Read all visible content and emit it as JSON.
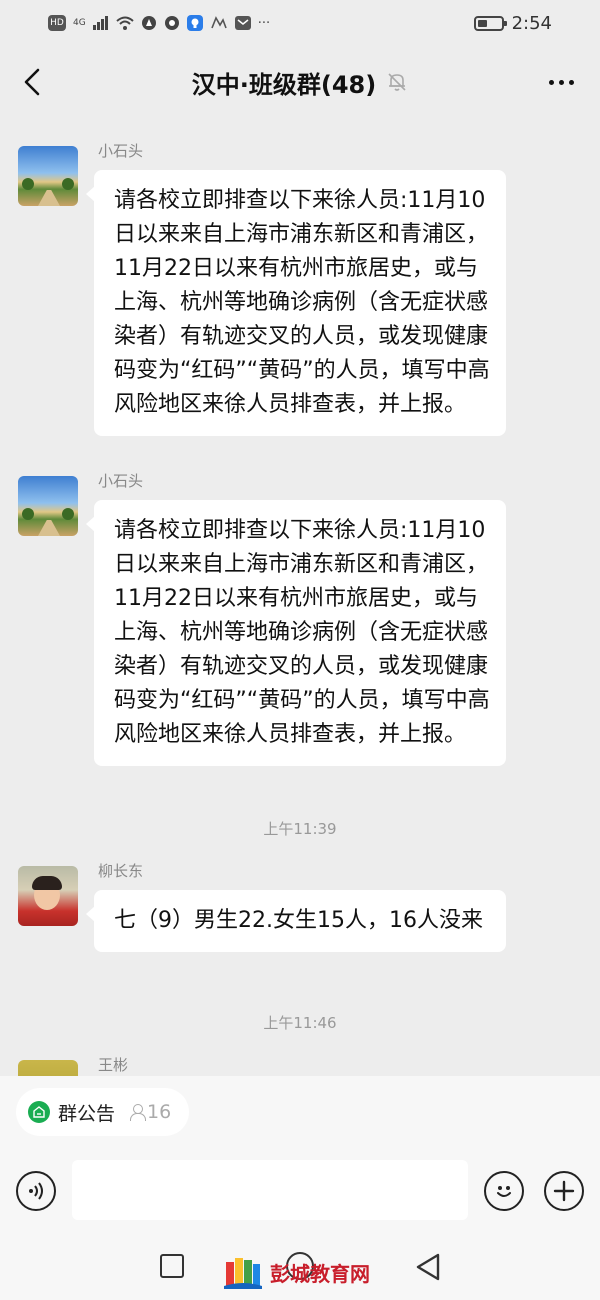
{
  "status_bar": {
    "network_labels": [
      "HD",
      "4G"
    ],
    "time": "2:54"
  },
  "header": {
    "title": "汉中·班级群(48)",
    "muted": true
  },
  "messages": [
    {
      "sender": "小石头",
      "avatar": "landscape-avatar",
      "text": "请各校立即排查以下来徐人员:11月10日以来来自上海市浦东新区和青浦区，11月22日以来有杭州市旅居史，或与上海、杭州等地确诊病例（含无症状感染者）有轨迹交叉的人员，或发现健康码变为“红码”“黄码”的人员，填写中高风险地区来徐人员排查表，并上报。"
    },
    {
      "sender": "小石头",
      "avatar": "landscape-avatar",
      "text": "请各校立即排查以下来徐人员:11月10日以来来自上海市浦东新区和青浦区，11月22日以来有杭州市旅居史，或与上海、杭州等地确诊病例（含无症状感染者）有轨迹交叉的人员，或发现健康码变为“红码”“黄码”的人员，填写中高风险地区来徐人员排查表，并上报。"
    },
    {
      "sender": "柳长东",
      "avatar": "child-avatar",
      "text": "七（9）男生22.女生15人，16人没来"
    },
    {
      "sender": "王彬",
      "avatar": "field-avatar",
      "text": ""
    }
  ],
  "time_separators": [
    "上午11:39",
    "上午11:46"
  ],
  "bottom": {
    "notice_label": "群公告",
    "notice_count": "16",
    "input_placeholder": ""
  },
  "watermark": {
    "text": "彭城教育网"
  },
  "colors": {
    "background": "#ededed",
    "bubble": "#ffffff",
    "accent_green": "#1aad52",
    "watermark_red": "#c81e2b"
  }
}
